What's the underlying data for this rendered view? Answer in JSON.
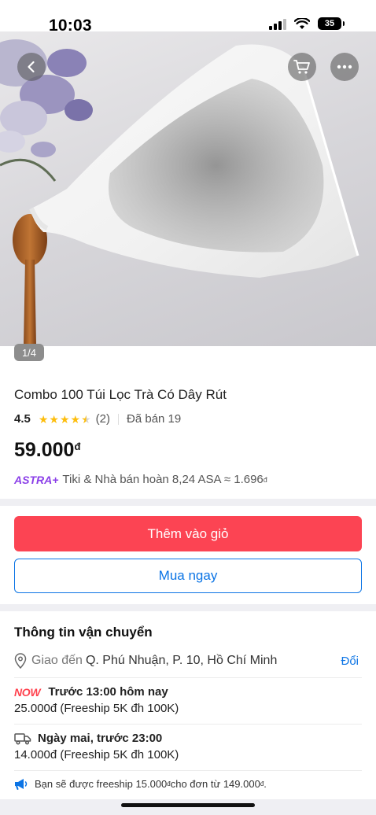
{
  "status": {
    "time": "10:03",
    "battery": "35"
  },
  "hero": {
    "image_counter": "1/4"
  },
  "icons": {
    "back": "back-arrow-icon",
    "cart": "cart-icon",
    "more": "more-icon",
    "location": "location-pin-icon",
    "truck": "truck-icon",
    "megaphone": "megaphone-icon"
  },
  "product": {
    "title": "Combo 100 Túi Lọc Trà Có Dây Rút",
    "rating_value": "4.5",
    "rating_count": "(2)",
    "sold": "Đã bán 19",
    "price": "59.000",
    "currency_symbol": "đ"
  },
  "astra": {
    "label": "ASTRA+",
    "text": "Tiki & Nhà bán hoàn 8,24 ASA ≈ 1.696",
    "currency_symbol": "đ"
  },
  "actions": {
    "add_to_cart": "Thêm vào giỏ",
    "buy_now": "Mua ngay"
  },
  "shipping": {
    "title": "Thông tin vận chuyển",
    "deliver_prefix": "Giao đến",
    "address": "Q. Phú Nhuận, P. 10, Hồ Chí Minh",
    "change": "Đổi",
    "option_now": {
      "badge": "NOW",
      "time": "Trước 13:00 hôm nay",
      "fee": "25.000đ (Freeship 5K đh 100K)"
    },
    "option_next": {
      "time": "Ngày mai, trước 23:00",
      "fee": "14.000đ (Freeship 5K đh 100K)"
    },
    "freeship_note_a": "Bạn sẽ được freeship 15.000",
    "freeship_note_b": " cho đơn từ 149.000",
    "freeship_note_c": ".",
    "currency_symbol": "đ"
  },
  "colors": {
    "accent_red": "#fc4453",
    "link_blue": "#0b74e5",
    "star": "#fdbd0b",
    "astra_purple": "#8a3ee8"
  }
}
